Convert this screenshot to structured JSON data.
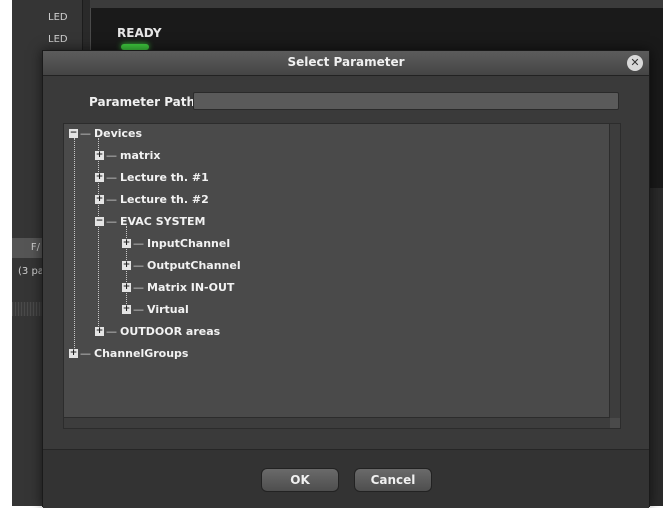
{
  "background": {
    "led_labels": [
      "LED",
      "LED"
    ],
    "ready_label": "READY",
    "side_tab_label": "F/",
    "side_info_label": "(3 pa",
    "colors": {
      "ready_led": "#3ec83e"
    }
  },
  "dialog": {
    "title": "Select Parameter",
    "close_icon": "close-circle-icon",
    "parameter_path_label": "Parameter Path",
    "parameter_path_value": "",
    "buttons": {
      "ok": "OK",
      "cancel": "Cancel"
    }
  },
  "tree": [
    {
      "label": "Devices",
      "state": "expanded",
      "depth": 0
    },
    {
      "label": "matrix",
      "state": "collapsed",
      "depth": 1
    },
    {
      "label": "Lecture th. #1",
      "state": "collapsed",
      "depth": 1
    },
    {
      "label": "Lecture th. #2",
      "state": "collapsed",
      "depth": 1
    },
    {
      "label": "EVAC SYSTEM",
      "state": "expanded",
      "depth": 1
    },
    {
      "label": "InputChannel",
      "state": "collapsed",
      "depth": 2
    },
    {
      "label": "OutputChannel",
      "state": "collapsed",
      "depth": 2
    },
    {
      "label": "Matrix IN-OUT",
      "state": "collapsed",
      "depth": 2
    },
    {
      "label": "Virtual",
      "state": "collapsed",
      "depth": 2
    },
    {
      "label": "OUTDOOR areas",
      "state": "collapsed",
      "depth": 1
    },
    {
      "label": "ChannelGroups",
      "state": "collapsed",
      "depth": 0
    }
  ]
}
